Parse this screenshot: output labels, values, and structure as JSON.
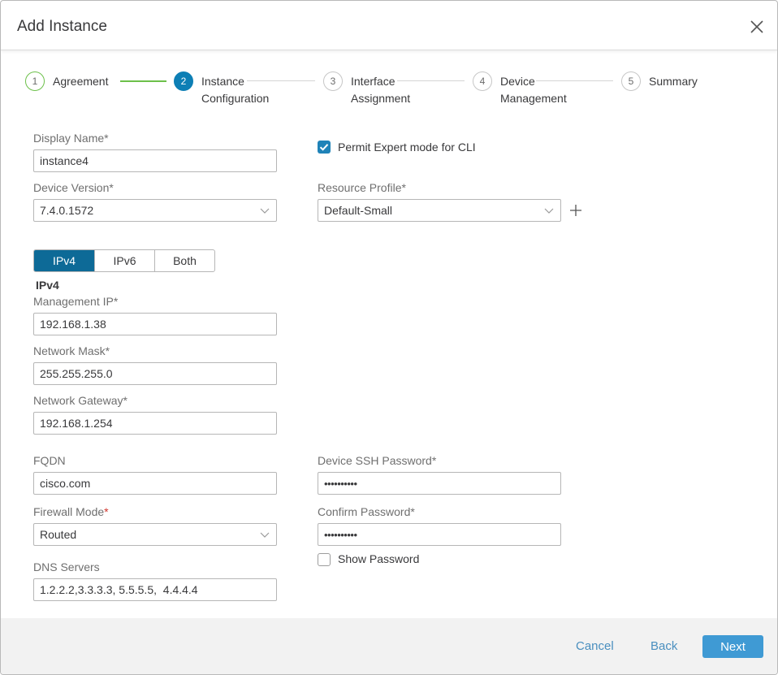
{
  "dialog": {
    "title": "Add Instance",
    "close_icon": "close-icon"
  },
  "stepper": {
    "steps": [
      {
        "number": "1",
        "line1": "Agreement",
        "line2": "",
        "state": "done"
      },
      {
        "number": "2",
        "line1": "Instance",
        "line2": "Configuration",
        "state": "active"
      },
      {
        "number": "3",
        "line1": "Interface",
        "line2": "Assignment",
        "state": "pending"
      },
      {
        "number": "4",
        "line1": "Device",
        "line2": "Management",
        "state": "pending"
      },
      {
        "number": "5",
        "line1": "Summary",
        "line2": "",
        "state": "pending"
      }
    ]
  },
  "form": {
    "display_name": {
      "label": "Display Name*",
      "value": "instance4"
    },
    "device_version": {
      "label": "Device Version*",
      "value": "7.4.0.1572"
    },
    "expert_mode": {
      "label": "Permit Expert mode for CLI",
      "checked": true
    },
    "resource_profile": {
      "label": "Resource Profile*",
      "value": "Default-Small"
    },
    "ip_mode": {
      "options": [
        "IPv4",
        "IPv6",
        "Both"
      ],
      "selected": "IPv4"
    },
    "ipv4_heading": "IPv4",
    "management_ip": {
      "label": "Management IP*",
      "value": "192.168.1.38"
    },
    "network_mask": {
      "label": "Network Mask*",
      "value": "255.255.255.0"
    },
    "network_gateway": {
      "label": "Network Gateway*",
      "value": "192.168.1.254"
    },
    "fqdn": {
      "label": "FQDN",
      "value": "cisco.com"
    },
    "firewall_mode": {
      "label": "Firewall Mode",
      "required_mark": "*",
      "value": "Routed"
    },
    "dns_servers": {
      "label": "DNS Servers",
      "value": "1.2.2.2,3.3.3.3, 5.5.5.5,  4.4.4.4"
    },
    "ssh_password": {
      "label": "Device SSH Password*",
      "value": "••••••••••"
    },
    "confirm_password": {
      "label": "Confirm Password*",
      "value": "••••••••••"
    },
    "show_password": {
      "label": "Show Password",
      "checked": false
    }
  },
  "footer": {
    "cancel_label": "Cancel",
    "back_label": "Back",
    "next_label": "Next"
  },
  "colors": {
    "primary": "#0d7fb5",
    "done": "#6cc04a",
    "button": "#3f9ad4",
    "link": "#4a8fbf",
    "required": "#d0342c"
  }
}
